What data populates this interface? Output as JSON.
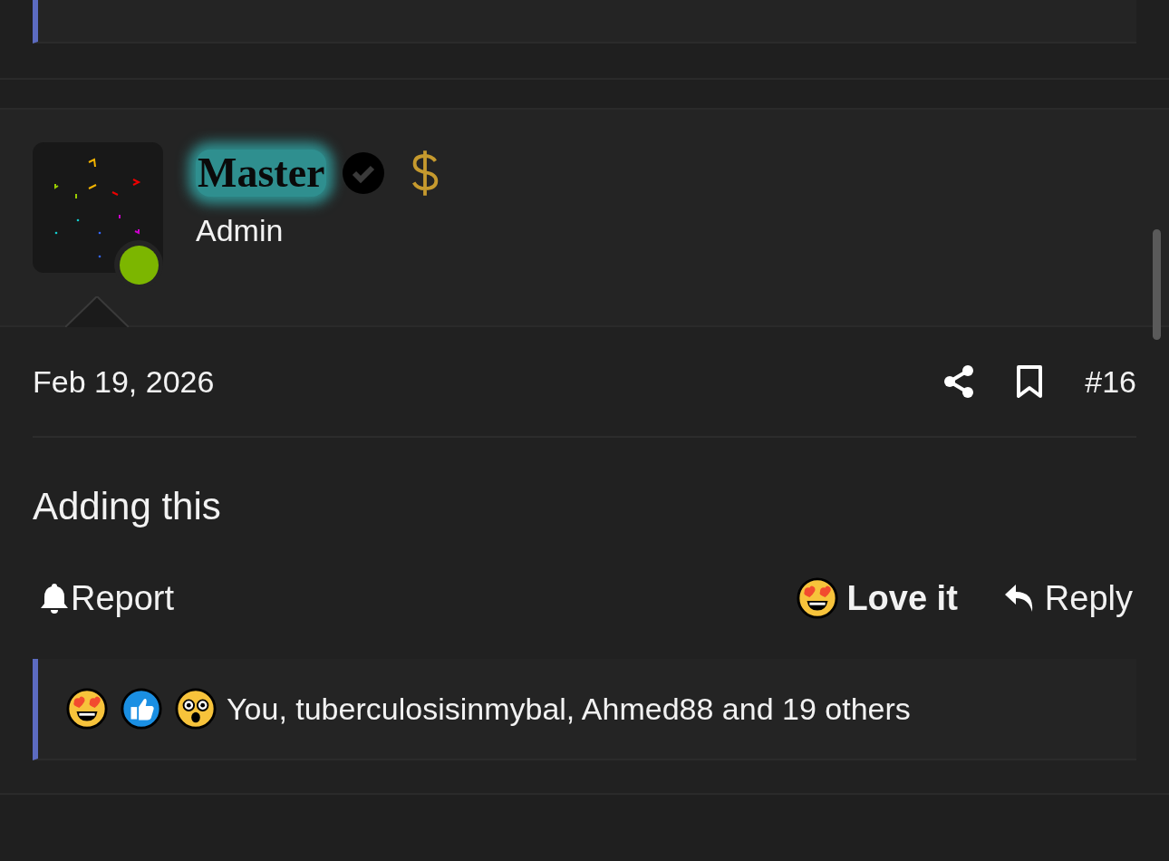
{
  "post": {
    "author": {
      "name": "Master",
      "verified": true,
      "role": "Admin",
      "online": true
    },
    "date": "Feb 19, 2026",
    "number": "#16",
    "content": "Adding this",
    "actions": {
      "report": "Report",
      "react": "Love it",
      "reply": "Reply"
    },
    "reactions": {
      "emojis": [
        {
          "kind": "love"
        },
        {
          "kind": "like"
        },
        {
          "kind": "wow"
        }
      ],
      "summary": "You, tuberculosisinmybal, Ahmed88 and 19 others"
    }
  }
}
